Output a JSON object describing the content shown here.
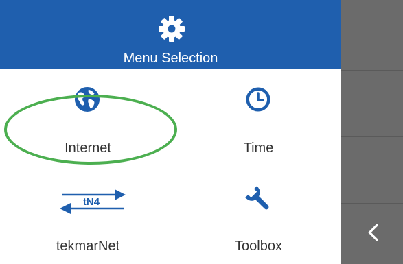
{
  "header": {
    "title": "Menu Selection",
    "icon": "gear-icon"
  },
  "tiles": [
    {
      "label": "Internet",
      "icon": "globe-icon"
    },
    {
      "label": "Time",
      "icon": "clock-icon"
    },
    {
      "label": "tekmarNet",
      "icon": "tekmarnet-icon",
      "icon_text": "tN4"
    },
    {
      "label": "Toolbox",
      "icon": "wrench-icon"
    }
  ],
  "side": {
    "back_icon": "chevron-left-icon"
  },
  "colors": {
    "header_bg": "#1f5fae",
    "icon_blue": "#1f5fae",
    "divider": "#3b6fb8",
    "highlight": "#4caf50",
    "side_bg": "#6b6b6b"
  }
}
